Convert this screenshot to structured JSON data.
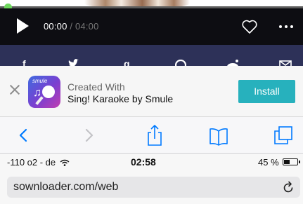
{
  "player": {
    "progress": 0.0,
    "current_time": "00:00",
    "separator": " / ",
    "duration": "04:00",
    "icons": {
      "play": "play-icon",
      "favorite": "heart-icon",
      "more": "more-icon"
    }
  },
  "share_bar": {
    "icons": [
      "facebook-icon",
      "twitter-icon",
      "google-plus-icon",
      "pinterest-icon",
      "reddit-icon",
      "email-icon"
    ]
  },
  "app_banner": {
    "line1": "Created With",
    "line2": "Sing! Karaoke by Smule",
    "app_icon_brand": "smule",
    "install_label": "Install",
    "install_color": "#27b1bd",
    "icons": {
      "close": "close-icon",
      "app": "smule-app-icon"
    }
  },
  "toolbar": {
    "color": "#007aff",
    "items": [
      {
        "name": "back",
        "icon": "chevron-left-icon",
        "enabled": true
      },
      {
        "name": "forward",
        "icon": "chevron-right-icon",
        "enabled": false
      },
      {
        "name": "share",
        "icon": "share-icon",
        "enabled": true
      },
      {
        "name": "bookmarks",
        "icon": "book-icon",
        "enabled": true
      },
      {
        "name": "tabs",
        "icon": "tabs-icon",
        "enabled": true
      }
    ]
  },
  "status_bar": {
    "carrier": "-110 o2 - de",
    "time": "02:58",
    "battery": "45 %",
    "battery_level": 0.45,
    "icons": {
      "wifi": "wifi-icon",
      "battery": "battery-icon"
    }
  },
  "address_bar": {
    "url": "sownloader.com/web",
    "icons": {
      "reload": "reload-icon"
    }
  }
}
